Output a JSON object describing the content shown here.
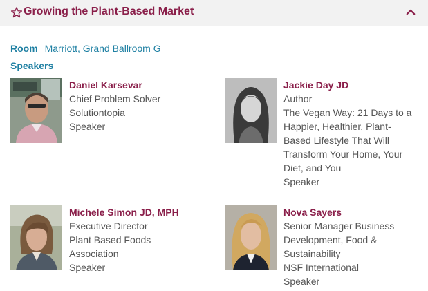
{
  "header": {
    "title": "Growing the Plant-Based Market",
    "star_icon": "star-outline-icon",
    "collapse_icon": "chevron-up-icon"
  },
  "room": {
    "label": "Room",
    "value": "Marriott, Grand Ballroom G"
  },
  "speakers_heading": "Speakers",
  "speakers": [
    {
      "name": "Daniel Karsevar",
      "lines": [
        "Chief Problem Solver",
        "Solutiontopia",
        "Speaker"
      ]
    },
    {
      "name": "Jackie Day JD",
      "lines": [
        "Author",
        "The Vegan Way: 21 Days to a",
        "Happier, Healthier, Plant-",
        "Based Lifestyle That Will",
        "Transform Your Home, Your",
        "Diet, and You",
        "Speaker"
      ]
    },
    {
      "name": "Michele Simon JD, MPH",
      "lines": [
        "Executive Director",
        "Plant Based Foods",
        "Association",
        "Speaker"
      ]
    },
    {
      "name": "Nova Sayers",
      "lines": [
        "Senior Manager Business",
        "Development, Food &",
        "Sustainability",
        "NSF International",
        "Speaker"
      ]
    }
  ],
  "colors": {
    "accent": "#8a1f4a",
    "link": "#1f80a3",
    "text": "#555555",
    "header_bg": "#f2f2f2"
  }
}
